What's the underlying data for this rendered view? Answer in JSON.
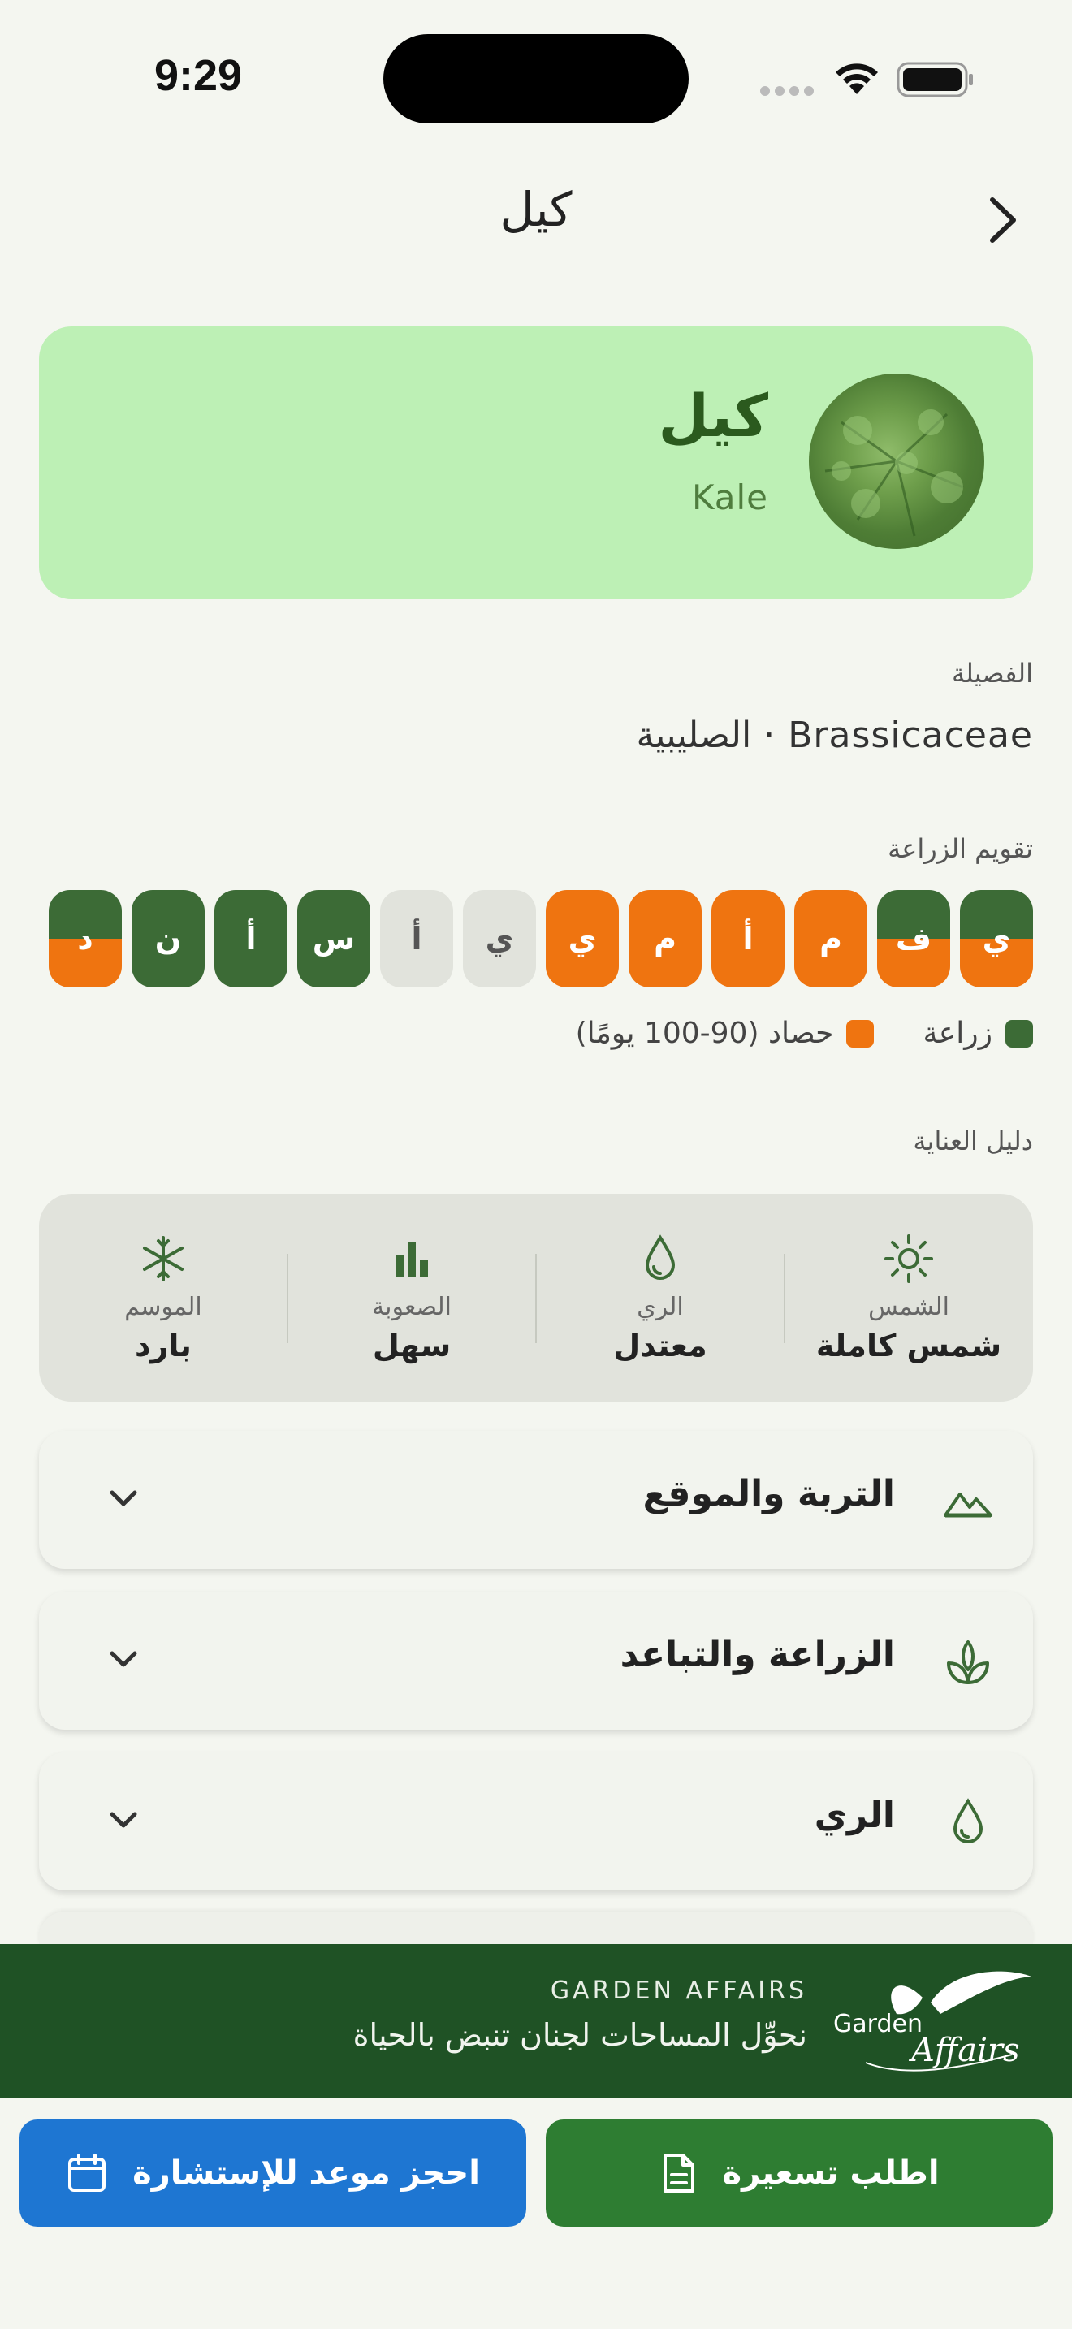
{
  "status_bar": {
    "time": "9:29"
  },
  "nav": {
    "title": "كيل"
  },
  "hero": {
    "name_ar": "كيل",
    "name_latin": "Kale"
  },
  "family": {
    "label": "الفصيلة",
    "value": "Brassicaceae · الصليبية"
  },
  "calendar": {
    "label": "تقويم الزراعة",
    "months": [
      {
        "letter": "ي",
        "state": "split"
      },
      {
        "letter": "ف",
        "state": "split"
      },
      {
        "letter": "م",
        "state": "harvest"
      },
      {
        "letter": "أ",
        "state": "harvest"
      },
      {
        "letter": "م",
        "state": "harvest"
      },
      {
        "letter": "ي",
        "state": "harvest"
      },
      {
        "letter": "ي",
        "state": "none"
      },
      {
        "letter": "أ",
        "state": "none"
      },
      {
        "letter": "س",
        "state": "plant"
      },
      {
        "letter": "أ",
        "state": "plant"
      },
      {
        "letter": "ن",
        "state": "plant"
      },
      {
        "letter": "د",
        "state": "split"
      }
    ],
    "legend_plant": "زراعة",
    "legend_harvest": "حصاد (90-100 يومًا)",
    "colors": {
      "plant": "#3c6b36",
      "harvest": "#ef7410",
      "none": "#e1e3dc"
    }
  },
  "care": {
    "label": "دليل العناية",
    "items": [
      {
        "icon": "sun-icon",
        "label": "الشمس",
        "value": "شمس كاملة"
      },
      {
        "icon": "water-drop-icon",
        "label": "الري",
        "value": "معتدل"
      },
      {
        "icon": "difficulty-bars-icon",
        "label": "الصعوبة",
        "value": "سهل"
      },
      {
        "icon": "snowflake-icon",
        "label": "الموسم",
        "value": "بارد"
      }
    ]
  },
  "sections": [
    {
      "title": "التربة والموقع",
      "icon": "soil-terrain-icon"
    },
    {
      "title": "الزراعة والتباعد",
      "icon": "sprout-icon"
    },
    {
      "title": "الري",
      "icon": "water-drop-icon"
    }
  ],
  "brand": {
    "name": "GARDEN AFFAIRS",
    "tagline": "نحوِّل المساحات لجنان تنبض بالحياة",
    "logo_text_1": "Garden",
    "logo_text_2": "Affairs"
  },
  "actions": {
    "quote": "اطلب تسعيرة",
    "consult": "احجز موعد للإستشارة"
  },
  "theme": {
    "accent_green": "#2e7d32",
    "accent_blue": "#1e76d2",
    "brand_green": "#1f5225"
  }
}
